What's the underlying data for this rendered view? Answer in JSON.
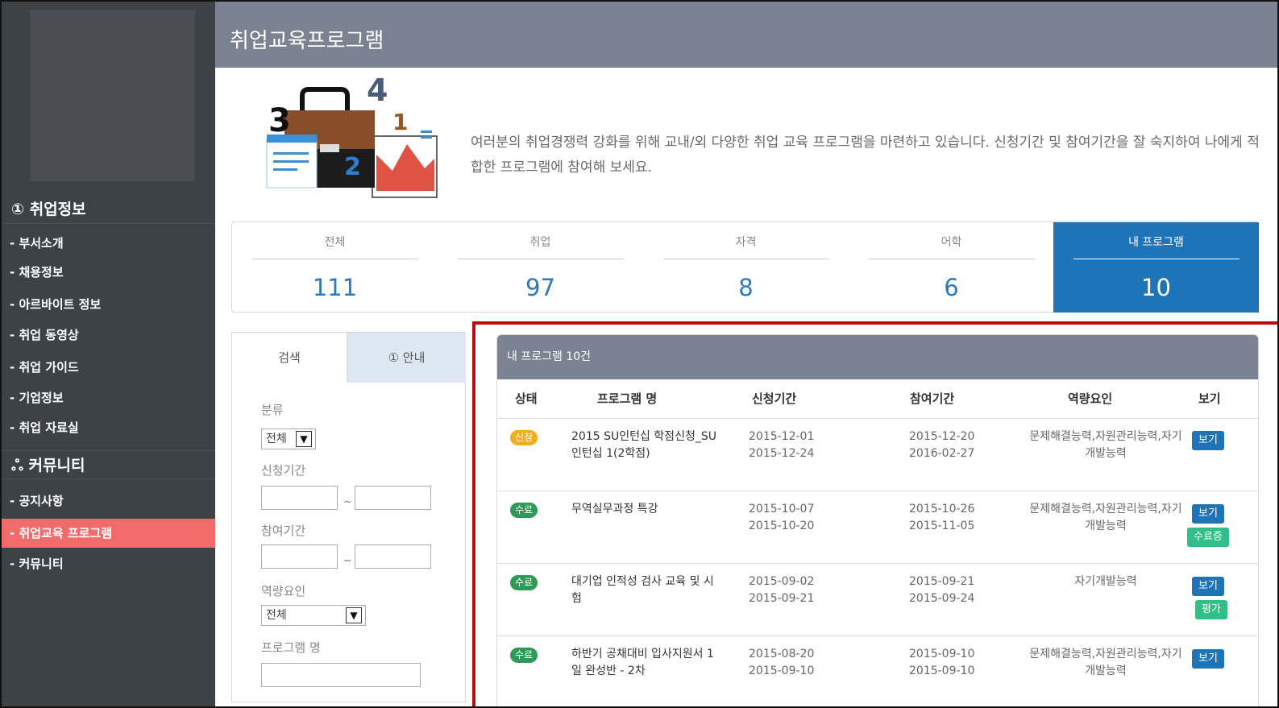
{
  "sidebar": {
    "section1": "① 취업정보",
    "items1": [
      "- 부서소개",
      "- 채용정보",
      "- 아르바이트 정보",
      "- 취업 동영상",
      "- 취업 가이드",
      "- 기업정보",
      "- 취업 자료실"
    ],
    "section2": "ஃ 커뮤니티",
    "items2": [
      "- 공지사항",
      "- 취업교육 프로그램",
      "- 커뮤니티"
    ],
    "active_item": "- 취업교육 프로그램"
  },
  "header": {
    "title": "취업교육프로그램"
  },
  "intro": {
    "text": "여러분의 취업경쟁력 강화를 위해 교내/외 다양한 취업 교육 프로그램을 마련하고 있습니다. 신청기간 및 참여기간을 잘 숙지하여 나에게 적합한 프로그램에 참여해 보세요."
  },
  "illustration": {
    "num3": "3",
    "num4": "4",
    "num1": "1",
    "num2": "2"
  },
  "stats": [
    {
      "label": "전체",
      "count": "111"
    },
    {
      "label": "취업",
      "count": "97"
    },
    {
      "label": "자격",
      "count": "8"
    },
    {
      "label": "어학",
      "count": "6"
    },
    {
      "label": "내 프로그램",
      "count": "10"
    }
  ],
  "search": {
    "tab_search": "검색",
    "tab_info": "① 안내",
    "category_label": "분류",
    "category_value": "전체",
    "apply_period_label": "신청기간",
    "participation_period_label": "참여기간",
    "capability_label": "역량요인",
    "capability_value": "전체",
    "program_name_label": "프로그램 명",
    "tilde": "~",
    "arrow": "▼"
  },
  "table": {
    "heading": "내 프로그램 10건",
    "columns": [
      "상태",
      "프로그램 명",
      "신청기간",
      "참여기간",
      "역량요인",
      "보기"
    ],
    "rows": [
      {
        "status": "신청",
        "name": "2015 SU인턴십 학점신청_SU인턴십 1(2학점)",
        "apply_start": "2015-12-01",
        "apply_end": "2015-12-24",
        "part_start": "2015-12-20",
        "part_end": "2016-02-27",
        "capability": "문제해결능력,자원관리능력,자기개발능력",
        "view": "보기",
        "extra": ""
      },
      {
        "status": "수료",
        "name": "무역실무과정 특강",
        "apply_start": "2015-10-07",
        "apply_end": "2015-10-20",
        "part_start": "2015-10-26",
        "part_end": "2015-11-05",
        "capability": "문제해결능력,자원관리능력,자기개발능력",
        "view": "보기",
        "extra": "수료증"
      },
      {
        "status": "수료",
        "name": "대기업 인적성 검사 교육 및 시험",
        "apply_start": "2015-09-02",
        "apply_end": "2015-09-21",
        "part_start": "2015-09-21",
        "part_end": "2015-09-24",
        "capability": "자기개발능력",
        "view": "보기",
        "extra": "평가"
      },
      {
        "status": "수료",
        "name": "하반기 공채대비 입사지원서 1일 완성반 - 2차",
        "apply_start": "2015-08-20",
        "apply_end": "2015-09-10",
        "part_start": "2015-09-10",
        "part_end": "2015-09-10",
        "capability": "문제해결능력,자원관리능력,자기개발능력",
        "view": "보기",
        "extra": ""
      }
    ]
  },
  "colors": {
    "sidebar": "#3d4246",
    "header": "#7b8291",
    "active_nav": "#f26b6b",
    "accent": "#1f73b7",
    "done_badge": "#2e9a57",
    "apply_badge": "#f0ad1e",
    "highlight_border": "#b50d12"
  }
}
